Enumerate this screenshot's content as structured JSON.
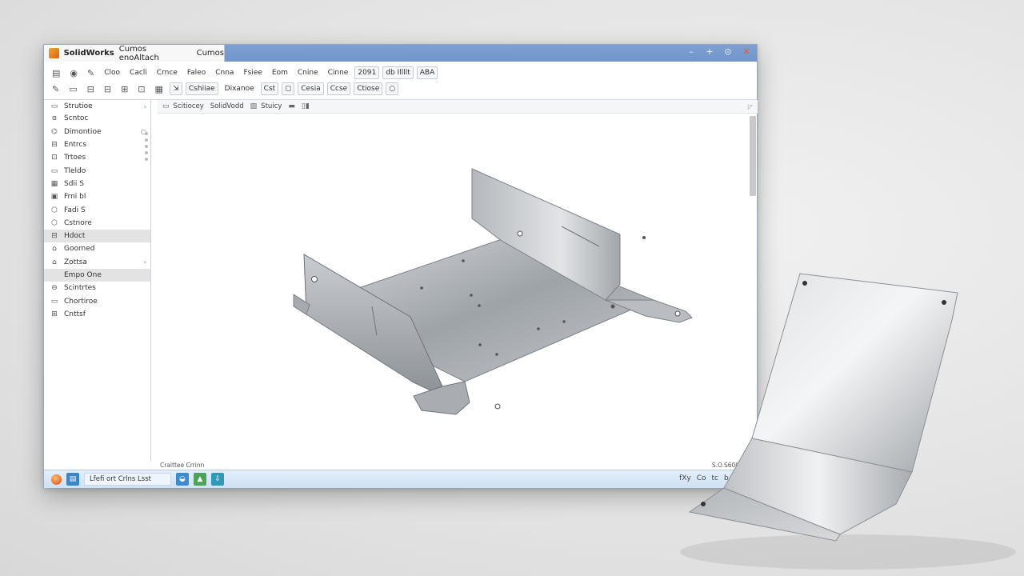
{
  "window": {
    "app_title": "SolidWorks",
    "doc_title": "Cumos enoAltach",
    "tab_title": "Cumos",
    "controls": [
      "–",
      "+",
      "⊙",
      "✕"
    ]
  },
  "toolbar1": [
    {
      "icon": "▤"
    },
    {
      "icon": "◉"
    },
    {
      "icon": "✎"
    },
    {
      "label": "Cloo"
    },
    {
      "label": "Cacli"
    },
    {
      "label": "Crnce"
    },
    {
      "label": "Faleo"
    },
    {
      "label": "Cnna"
    },
    {
      "label": "Fsiee"
    },
    {
      "label": "Eom"
    },
    {
      "label": "Cnine"
    },
    {
      "label": "Cinne"
    },
    {
      "label": "2091",
      "boxed": true
    },
    {
      "label": "db Illllt",
      "boxed": true
    },
    {
      "label": "ABA",
      "boxed": true
    }
  ],
  "toolbar2": [
    {
      "icon": "✎"
    },
    {
      "icon": "▭"
    },
    {
      "icon": "⊟"
    },
    {
      "icon": "⊟"
    },
    {
      "icon": "⊞"
    },
    {
      "icon": "⊡"
    },
    {
      "icon": "▦"
    },
    {
      "label": "⇲",
      "boxed": true
    },
    {
      "label": "Cshiiae",
      "boxed": true
    },
    {
      "label": "Dixanoe"
    },
    {
      "label": "Cst",
      "boxed": true
    },
    {
      "label": "◻",
      "boxed": true
    },
    {
      "label": "Cesia",
      "boxed": true
    },
    {
      "label": "Ccse",
      "boxed": true
    },
    {
      "label": "Ctiose",
      "boxed": true
    },
    {
      "label": "○",
      "boxed": true
    }
  ],
  "sidebar": [
    {
      "icon": "▭",
      "label": "Strutioe",
      "arrow": "›"
    },
    {
      "icon": "ɞ",
      "label": "Scntoc"
    },
    {
      "icon": "⌬",
      "label": "Dimontioe",
      "hl": false,
      "arrow": "○"
    },
    {
      "icon": "⊟",
      "label": "Entrcs"
    },
    {
      "icon": "⊡",
      "label": "Trtoes"
    },
    {
      "icon": "▭",
      "label": "Tleldo"
    },
    {
      "icon": "▦",
      "label": "Sdii S"
    },
    {
      "icon": "▣",
      "label": "Frni bl"
    },
    {
      "icon": "⬡",
      "label": "Fadi S"
    },
    {
      "icon": "⬡",
      "label": "Cstnore"
    },
    {
      "icon": "⊟",
      "label": "Hdoct",
      "hl": true
    },
    {
      "icon": "⌂",
      "label": "Goorned"
    },
    {
      "icon": "⌂",
      "label": "Zottsa",
      "arrow": "›"
    },
    {
      "icon": "",
      "label": "Empo One",
      "hl": true
    },
    {
      "icon": "⊖",
      "label": "Scintrtes"
    },
    {
      "icon": "▭",
      "label": "Chortiroe"
    },
    {
      "icon": "⊞",
      "label": "Cnttsf"
    }
  ],
  "view_tabs": [
    {
      "icon": "▭",
      "label": "Scitiocey"
    },
    {
      "icon": "",
      "label": "SolidVodd"
    },
    {
      "icon": "▨",
      "label": "Stuicy"
    },
    {
      "icon": "▬",
      "label": ""
    },
    {
      "icon": "▯▮",
      "label": ""
    }
  ],
  "view_close": "◸",
  "status": {
    "left": "Craittee Crrinn",
    "right": "S.O.S6000b."
  },
  "taskbar": {
    "task_label": "Lfefi ort Crlns Lsst",
    "tray": [
      "fXy",
      "Co",
      "tc",
      "b",
      "⊡",
      "♪"
    ]
  },
  "colors": {
    "titlebar": "#7096cc",
    "accent": "#e25b2a",
    "taskbar": "#cfe1f4"
  }
}
